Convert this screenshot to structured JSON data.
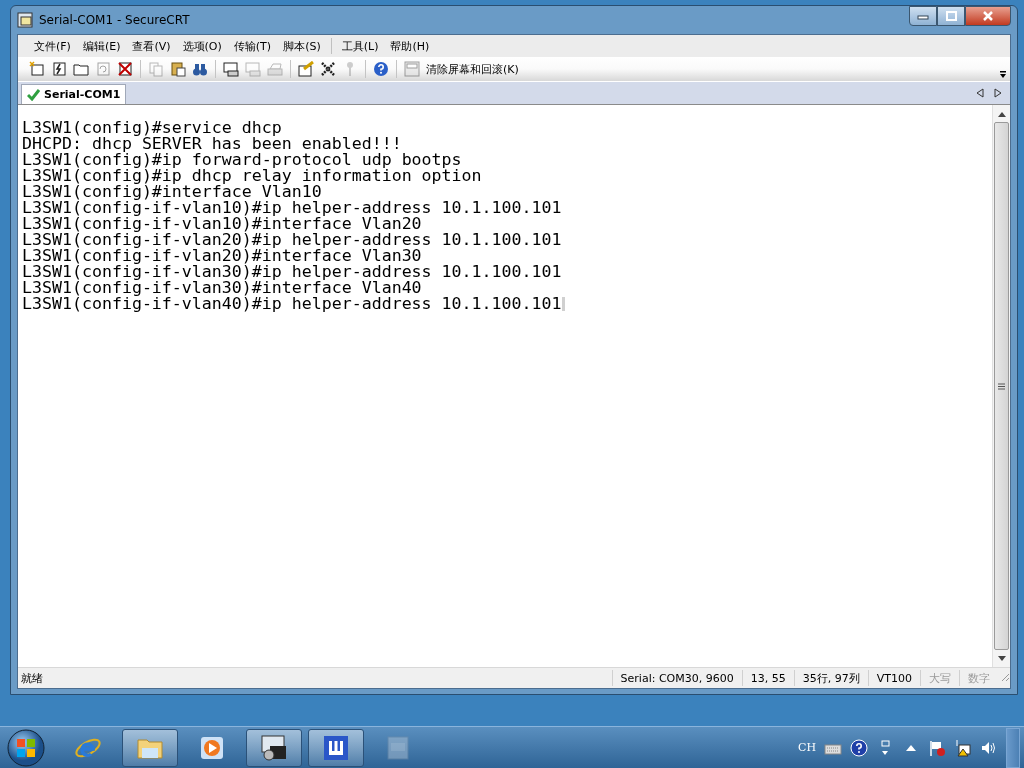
{
  "window": {
    "title": "Serial-COM1 - SecureCRT"
  },
  "menu": [
    {
      "label": "文件(F)"
    },
    {
      "label": "编辑(E)"
    },
    {
      "label": "查看(V)"
    },
    {
      "label": "选项(O)"
    },
    {
      "label": "传输(T)"
    },
    {
      "label": "脚本(S)"
    },
    {
      "kind": "separator"
    },
    {
      "label": "工具(L)"
    },
    {
      "label": "帮助(H)"
    }
  ],
  "toolbar": {
    "buttons": [
      {
        "kind": "button",
        "disabled": false
      },
      {
        "kind": "button",
        "disabled": false
      },
      {
        "kind": "button",
        "disabled": false
      },
      {
        "kind": "button",
        "disabled": true
      },
      {
        "kind": "button",
        "disabled": false
      },
      {
        "kind": "separator"
      },
      {
        "kind": "button",
        "disabled": true
      },
      {
        "kind": "button",
        "disabled": false
      },
      {
        "kind": "button",
        "disabled": false
      },
      {
        "kind": "separator"
      },
      {
        "kind": "button",
        "disabled": false
      },
      {
        "kind": "button",
        "disabled": true
      },
      {
        "kind": "button",
        "disabled": true
      },
      {
        "kind": "separator"
      },
      {
        "kind": "button",
        "disabled": false
      },
      {
        "kind": "button",
        "disabled": false
      },
      {
        "kind": "button",
        "disabled": true
      },
      {
        "kind": "separator"
      },
      {
        "kind": "button",
        "disabled": false
      },
      {
        "kind": "separator"
      },
      {
        "kind": "button",
        "disabled": true
      }
    ],
    "clear_label": "清除屏幕和回滚(K)"
  },
  "tabs": [
    {
      "label": "Serial-COM1",
      "selected": true,
      "connected": true
    }
  ],
  "terminal": {
    "lines": [
      "L3SW1(config)#service dhcp",
      "DHCPD: dhcp SERVER has been enabled!!!",
      "L3SW1(config)#ip forward-protocol udp bootps",
      "L3SW1(config)#ip dhcp relay information option",
      "L3SW1(config)#interface Vlan10",
      "L3SW1(config-if-vlan10)#ip helper-address 10.1.100.101",
      "L3SW1(config-if-vlan10)#interface Vlan20",
      "L3SW1(config-if-vlan20)#ip helper-address 10.1.100.101",
      "L3SW1(config-if-vlan20)#interface Vlan30",
      "L3SW1(config-if-vlan30)#ip helper-address 10.1.100.101",
      "L3SW1(config-if-vlan30)#interface Vlan40",
      "L3SW1(config-if-vlan40)#ip helper-address 10.1.100.101"
    ],
    "cursor_visible": true
  },
  "status_bar": {
    "message": "就绪",
    "fields": [
      {
        "text": "Serial: COM30, 9600",
        "disabled": false
      },
      {
        "text": "13,  55",
        "disabled": false
      },
      {
        "text": "35行, 97列",
        "disabled": false
      },
      {
        "text": "VT100",
        "disabled": false
      },
      {
        "text": "大写",
        "disabled": true
      },
      {
        "text": "数字",
        "disabled": true
      }
    ]
  },
  "taskbar": {
    "apps": [
      {
        "selected": false
      },
      {
        "selected": true
      },
      {
        "selected": false
      },
      {
        "selected": true
      },
      {
        "selected": true
      },
      {
        "selected": false
      }
    ],
    "tray": {
      "language": "CH"
    }
  }
}
